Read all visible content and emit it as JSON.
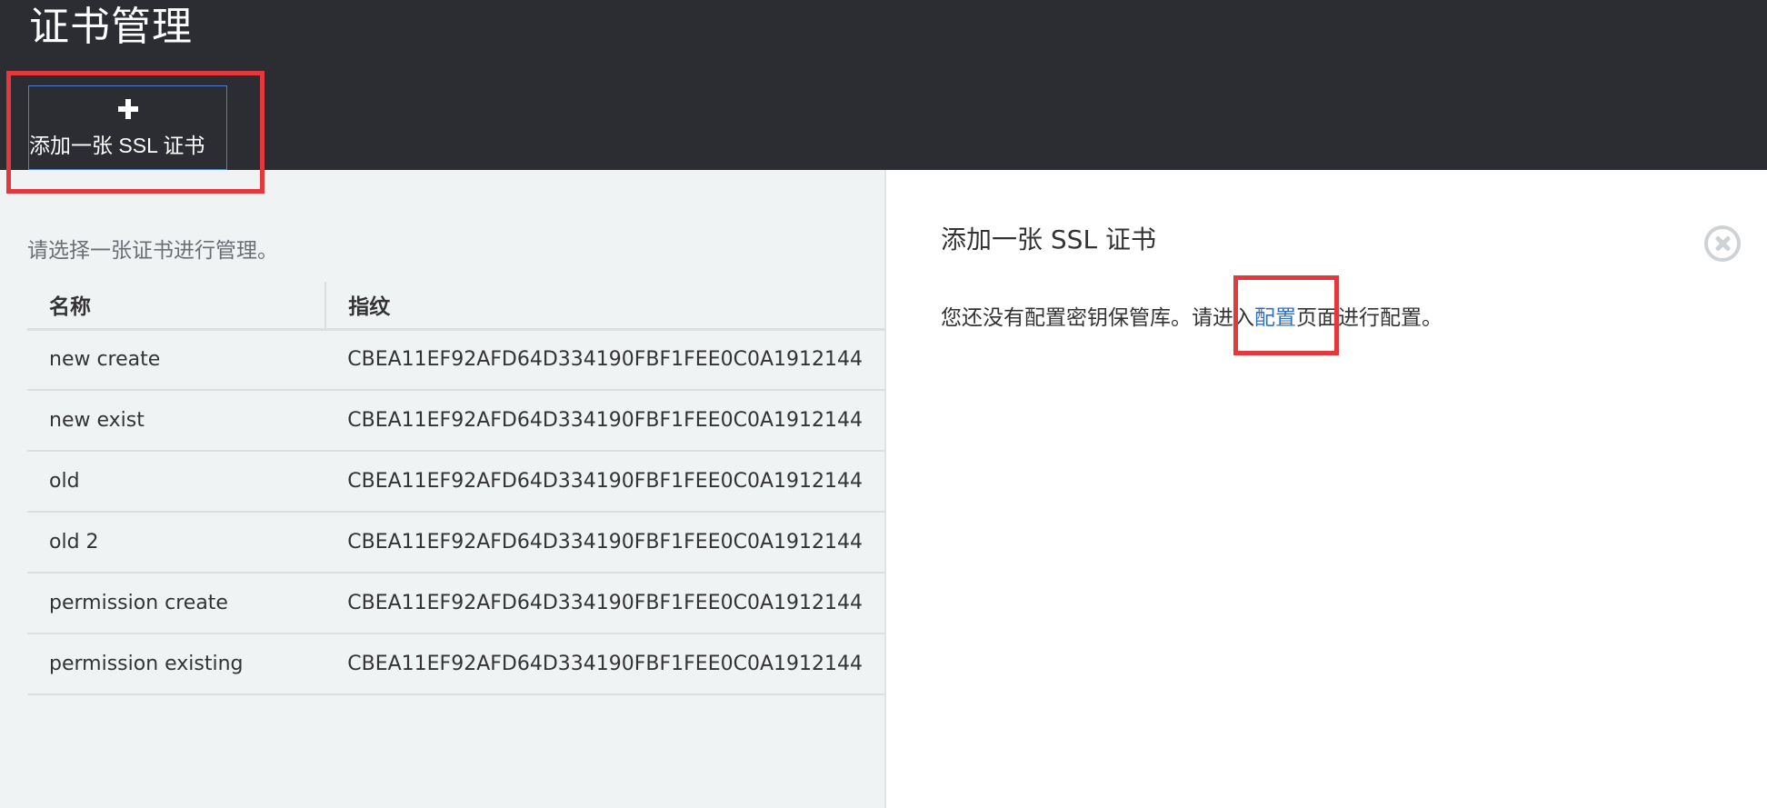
{
  "header": {
    "title": "证书管理",
    "add_button_label": "添加一张 SSL 证书",
    "add_button_icon": "plus-icon"
  },
  "left_panel": {
    "instruction": "请选择一张证书进行管理。",
    "table": {
      "columns": [
        "名称",
        "指纹"
      ],
      "rows": [
        {
          "name": "new create",
          "fingerprint": "CBEA11EF92AFD64D334190FBF1FEE0C0A1912144"
        },
        {
          "name": "new exist",
          "fingerprint": "CBEA11EF92AFD64D334190FBF1FEE0C0A1912144"
        },
        {
          "name": "old",
          "fingerprint": "CBEA11EF92AFD64D334190FBF1FEE0C0A1912144"
        },
        {
          "name": "old 2",
          "fingerprint": "CBEA11EF92AFD64D334190FBF1FEE0C0A1912144"
        },
        {
          "name": "permission create",
          "fingerprint": "CBEA11EF92AFD64D334190FBF1FEE0C0A1912144"
        },
        {
          "name": "permission existing",
          "fingerprint": "CBEA11EF92AFD64D334190FBF1FEE0C0A1912144"
        }
      ]
    }
  },
  "right_panel": {
    "title": "添加一张 SSL 证书",
    "message_before": "您还没有配置密钥保管库。请进入",
    "message_link": "配置",
    "message_after": "页面进行配置。",
    "close_icon": "close-circle-icon"
  },
  "colors": {
    "header_bg": "#2b2d33",
    "left_panel_bg": "#f0f3f4",
    "link": "#2f6fc4",
    "highlight": "#e4383c"
  }
}
